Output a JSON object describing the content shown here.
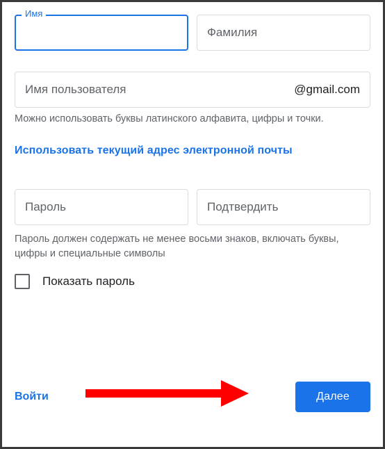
{
  "name_row": {
    "first_name_label": "Имя",
    "first_name_value": "",
    "last_name_placeholder": "Фамилия"
  },
  "username": {
    "placeholder": "Имя пользователя",
    "suffix": "@gmail.com",
    "hint": "Можно использовать буквы латинского алфавита, цифры и точки."
  },
  "use_current_email_link": "Использовать текущий адрес электронной почты",
  "password": {
    "placeholder": "Пароль",
    "confirm_placeholder": "Подтвердить",
    "hint": "Пароль должен содержать не менее восьми знаков, включать буквы, цифры и специальные символы"
  },
  "show_password_label": "Показать пароль",
  "signin_link": "Войти",
  "next_button": "Далее",
  "colors": {
    "accent": "#1a73e8",
    "arrow": "#ff0000"
  }
}
